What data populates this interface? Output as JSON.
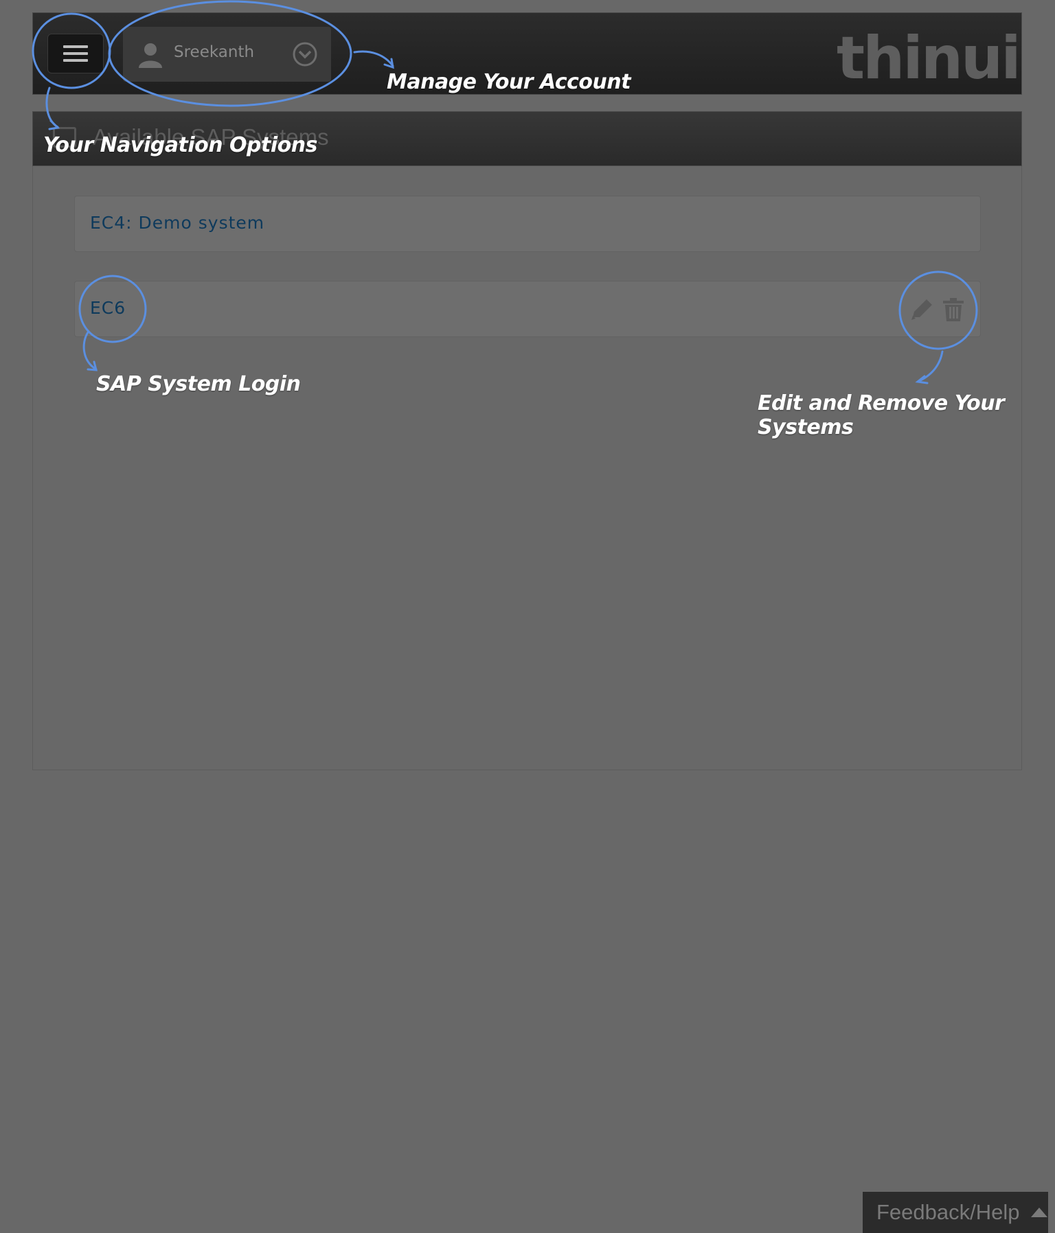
{
  "header": {
    "user_name": "Sreekanth",
    "logo_text": "thinui",
    "menu_icon": "hamburger-menu-icon",
    "avatar_icon": "user-avatar-icon",
    "dropdown_icon": "chevron-down-circle-icon"
  },
  "panel": {
    "title": "Available SAP Systems",
    "systems": [
      {
        "label": "EC4: Demo system"
      },
      {
        "label": "EC6"
      }
    ],
    "edit_icon": "pencil-icon",
    "remove_icon": "trash-icon"
  },
  "annotations": {
    "navigation": "Your Navigation Options",
    "account": "Manage Your Account",
    "login": "SAP System Login",
    "edit_remove": "Edit and Remove Your Systems"
  },
  "footer": {
    "feedback_label": "Feedback/Help",
    "feedback_icon": "caret-up-icon"
  },
  "colors": {
    "page_background": "#686868",
    "annotation_stroke": "#5b8fe0",
    "annotation_text": "#ffffff",
    "system_link": "#0e3a5c"
  }
}
